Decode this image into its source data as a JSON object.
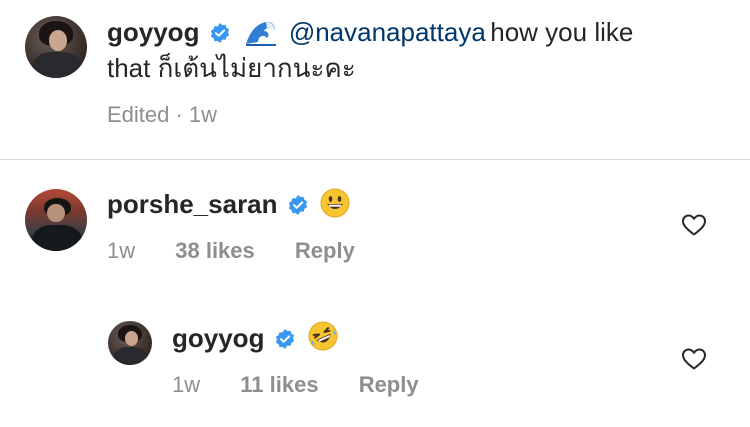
{
  "caption": {
    "username": "goyyog",
    "mention": "@navanapattaya",
    "text_line1": "how you like",
    "text_line2": "that ก็เต้นไม่ยากนะคะ",
    "meta": "Edited · 1w"
  },
  "comments": [
    {
      "username": "porshe_saran",
      "emoji": "grinning-face",
      "time": "1w",
      "likes": "38 likes",
      "reply_label": "Reply"
    },
    {
      "username": "goyyog",
      "emoji": "rolling-on-floor-laughing",
      "time": "1w",
      "likes": "11 likes",
      "reply_label": "Reply"
    }
  ],
  "colors": {
    "verified_blue": "#3897f0",
    "mention": "#00376b",
    "meta_gray": "#8e8e8e",
    "divider": "#dbdbdb"
  }
}
